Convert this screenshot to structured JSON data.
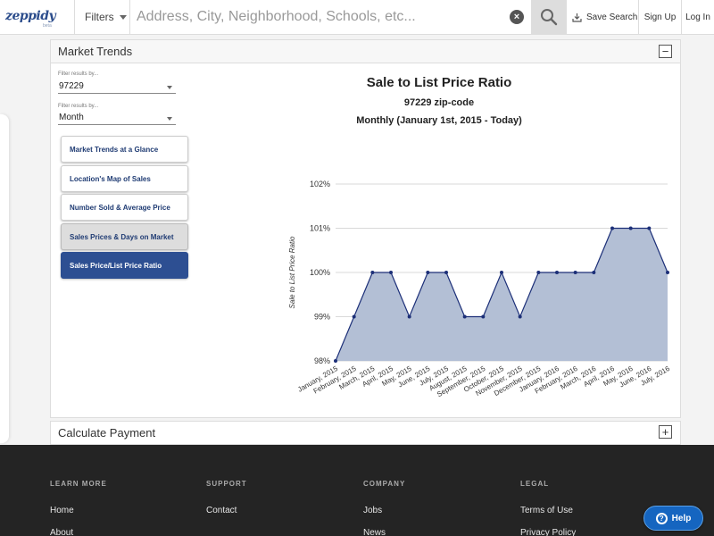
{
  "header": {
    "logo": "zeppidy",
    "logo_sub": "beta",
    "filters_label": "Filters",
    "search_placeholder": "Address, City, Neighborhood, Schools, etc...",
    "search_value": "",
    "clear_symbol": "×",
    "save_search_label": "Save Search",
    "signup_label": "Sign Up",
    "login_label": "Log In"
  },
  "market_trends": {
    "title": "Market Trends",
    "collapse_symbol": "−",
    "filter1": {
      "label": "Filter results by...",
      "value": "97229"
    },
    "filter2": {
      "label": "Filter results by...",
      "value": "Month"
    },
    "nav": [
      {
        "label": "Market Trends at a Glance",
        "state": "normal"
      },
      {
        "label": "Location's Map of Sales",
        "state": "normal"
      },
      {
        "label": "Number Sold & Average Price",
        "state": "normal"
      },
      {
        "label": "Sales Prices & Days on Market",
        "state": "hover"
      },
      {
        "label": "Sales Price/List Price Ratio",
        "state": "active"
      }
    ]
  },
  "chart_data": {
    "type": "area",
    "title": "Sale to List Price Ratio",
    "subtitle": "97229 zip-code",
    "subtitle2": "Monthly (January 1st, 2015 - Today)",
    "ylabel": "Sale to List Price Ratio",
    "xlabel": "",
    "ylim": [
      98,
      102
    ],
    "yticks": [
      98,
      99,
      100,
      101,
      102
    ],
    "ytick_suffix": "%",
    "grid": true,
    "categories": [
      "January, 2015",
      "February, 2015",
      "March, 2015",
      "April, 2015",
      "May, 2015",
      "June, 2015",
      "July, 2015",
      "August, 2015",
      "September, 2015",
      "October, 2015",
      "November, 2015",
      "December, 2015",
      "January, 2016",
      "February, 2016",
      "March, 2016",
      "April, 2016",
      "May, 2016",
      "June, 2016",
      "July, 2016"
    ],
    "values": [
      98,
      99,
      100,
      100,
      99,
      100,
      100,
      99,
      99,
      100,
      99,
      100,
      100,
      100,
      100,
      101,
      101,
      101,
      100
    ],
    "colors": {
      "fill": "#b3bfd5",
      "line": "#1c2f78",
      "point": "#1c2f78",
      "grid": "#d9d9d9"
    }
  },
  "calculate_payment": {
    "title": "Calculate Payment",
    "expand_symbol": "+"
  },
  "footer": {
    "columns": [
      {
        "heading": "LEARN MORE",
        "links": [
          "Home",
          "About"
        ]
      },
      {
        "heading": "SUPPORT",
        "links": [
          "Contact"
        ]
      },
      {
        "heading": "COMPANY",
        "links": [
          "Jobs",
          "News"
        ]
      },
      {
        "heading": "LEGAL",
        "links": [
          "Terms of Use",
          "Privacy Policy"
        ]
      }
    ],
    "help_label": "Help",
    "help_icon": "?"
  },
  "colors": {
    "brand": "#2c4d8c",
    "active_button": "#2d4f92",
    "footer_bg": "#242424",
    "help_button": "#1565c0"
  }
}
